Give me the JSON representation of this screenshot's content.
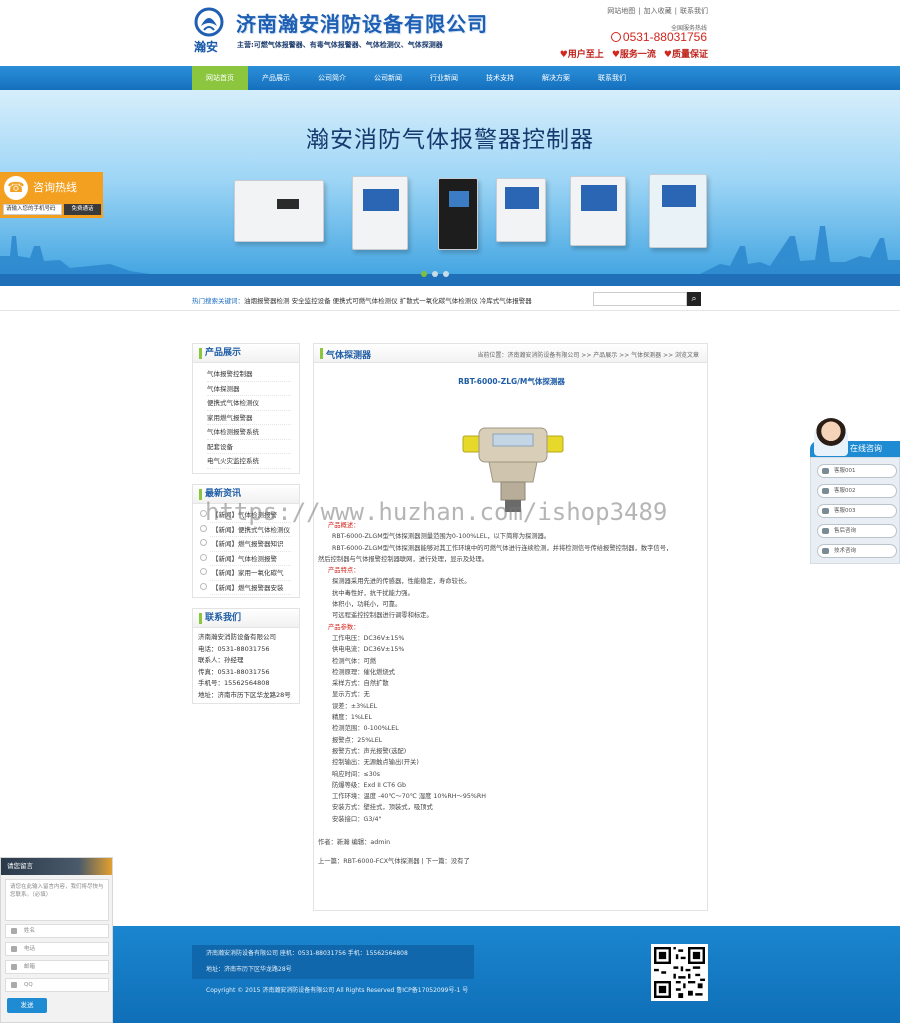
{
  "header": {
    "logo_text": "瀚安",
    "company_name": "济南瀚安消防设备有限公司",
    "business_scope": "主营:可燃气体报警器、有毒气体报警器、气体检测仪、气体探测器",
    "top_links": [
      "网站地图",
      "加入收藏",
      "联系我们"
    ],
    "hotline_label": "全国服务热线",
    "hotline": "0531-88031756",
    "slogans": [
      "用户至上",
      "服务一流",
      "质量保证"
    ]
  },
  "nav": {
    "items": [
      "网站首页",
      "产品展示",
      "公司简介",
      "公司新闻",
      "行业新闻",
      "技术支持",
      "解决方案",
      "联系我们"
    ],
    "active_index": 0
  },
  "banner": {
    "title": "瀚安消防气体报警器控制器",
    "slide_count": 3,
    "active_slide": 0
  },
  "consult": {
    "title": "咨询热线",
    "input_value": "请输入您的手机号码",
    "button": "免费通话"
  },
  "search": {
    "hot_label": "热门搜索关键词：",
    "hot_words": "油烟报警器检测 安全监控设备 便携式可燃气体检测仪 扩散式一氧化碳气体检测仪 冷库式气体报警器",
    "button_icon": "search-icon"
  },
  "sidebar": {
    "products_title": "产品展示",
    "products": [
      "气体报警控制器",
      "气体探测器",
      "便携式气体检测仪",
      "家用燃气报警器",
      "气体检测报警系统",
      "配套设备",
      "电气火灾监控系统"
    ],
    "news_title": "最新资讯",
    "news": [
      "【新闻】气体检测报警",
      "【新闻】便携式气体检测仪",
      "【新闻】燃气报警器知识",
      "【新闻】气体检测报警",
      "【新闻】家用一氧化碳气",
      "【新闻】燃气报警器安装"
    ],
    "contact_title": "联系我们",
    "contact": [
      "济南瀚安消防设备有限公司",
      "电话：0531-88031756",
      "联系人：孙经理",
      "传真：0531-88031756",
      "手机号：15562564808",
      "地址：济南市历下区华龙路28号"
    ]
  },
  "main": {
    "title": "气体探测器",
    "breadcrumb": "当前位置：济南瀚安消防设备有限公司 >> 产品展示 >> 气体探测器 >> 浏览文章",
    "product_title": "RBT-6000-ZLG/M气体探测器",
    "lines": [
      {
        "cls": "hl ind2",
        "text": "产品概述："
      },
      {
        "cls": "ind",
        "text": "RBT-6000-ZLGM型气体探测器测量范围为0-100%LEL，以下简称为探测器。"
      },
      {
        "cls": "ind",
        "text": "RBT-6000-ZLGM型气体探测器能够对其工作环境中的可燃气体进行连续检测，并将检测信号传给报警控制器，数字信号，"
      },
      {
        "cls": "",
        "text": "然后控制器与气体报警控制器联网，进行处理，显示及处理。"
      },
      {
        "cls": "hl ind2",
        "text": "产品特点："
      },
      {
        "cls": "ind",
        "text": "探测器采用先进的传感器，性能稳定，寿命较长。"
      },
      {
        "cls": "ind",
        "text": "抗中毒性好，抗干扰能力强。"
      },
      {
        "cls": "ind",
        "text": "体积小，功耗小，可靠。"
      },
      {
        "cls": "ind",
        "text": "可远程遥控控制器进行调零和标定。"
      },
      {
        "cls": "hl ind2",
        "text": "产品参数："
      },
      {
        "cls": "ind",
        "text": "工作电压：DC36V±15%"
      },
      {
        "cls": "ind",
        "text": "供电电流：DC36V±15%"
      },
      {
        "cls": "ind",
        "text": "检测气体：可燃"
      },
      {
        "cls": "ind",
        "text": "检测原理：催化燃烧式"
      },
      {
        "cls": "ind",
        "text": "采样方式：自然扩散"
      },
      {
        "cls": "ind",
        "text": "显示方式：无"
      },
      {
        "cls": "ind",
        "text": "误差：±3%LEL"
      },
      {
        "cls": "ind",
        "text": "精度：1%LEL"
      },
      {
        "cls": "ind",
        "text": "检测范围：0-100%LEL"
      },
      {
        "cls": "ind",
        "text": "报警点：25%LEL"
      },
      {
        "cls": "ind",
        "text": "报警方式：声光报警(选配)"
      },
      {
        "cls": "ind",
        "text": "控制输出：无源触点输出(开关)"
      },
      {
        "cls": "ind",
        "text": "响应时间：≤30s"
      },
      {
        "cls": "ind",
        "text": "防爆等级：Exd II CT6 Gb"
      },
      {
        "cls": "ind",
        "text": "工作环境：温度 -40℃～70℃ 湿度 10%RH～95%RH"
      },
      {
        "cls": "ind",
        "text": "安装方式：壁挂式，顶装式，吸顶式"
      },
      {
        "cls": "ind",
        "text": "安装接口：G3/4\""
      }
    ],
    "meta": "作者：新瀚 编辑：admin",
    "prev_next": "上一篇：RBT-6000-FCX气体探测器 | 下一篇：没有了"
  },
  "watermark": "https://www.huzhan.com/ishop3489",
  "footer": {
    "info_line1": "济南瀚安消防设备有限公司 座机：0531-88031756 手机：15562564808",
    "info_line2": "地址：济南市历下区华龙路28号",
    "copyright": "Copyright © 2015 济南瀚安消防设备有限公司 All Rights Reserved 鲁ICP备17052099号-1 号"
  },
  "online_service": {
    "title": "在线咨询",
    "items": [
      "客服001",
      "客服002",
      "客服003",
      "售后咨询",
      "技术咨询"
    ]
  },
  "leave_message": {
    "title": "请您留言",
    "textarea_placeholder": "请您在此输入留言内容，我们将尽快与您联系。（必填）",
    "fields": [
      "姓名",
      "电话",
      "邮箱",
      "QQ"
    ],
    "send": "发送"
  },
  "colors": {
    "brand_blue": "#1e5fb3",
    "nav_blue": "#1f7fcc",
    "nav_active": "#8cc63f",
    "accent_red": "#d2261e",
    "consult_orange": "#f3a021"
  }
}
